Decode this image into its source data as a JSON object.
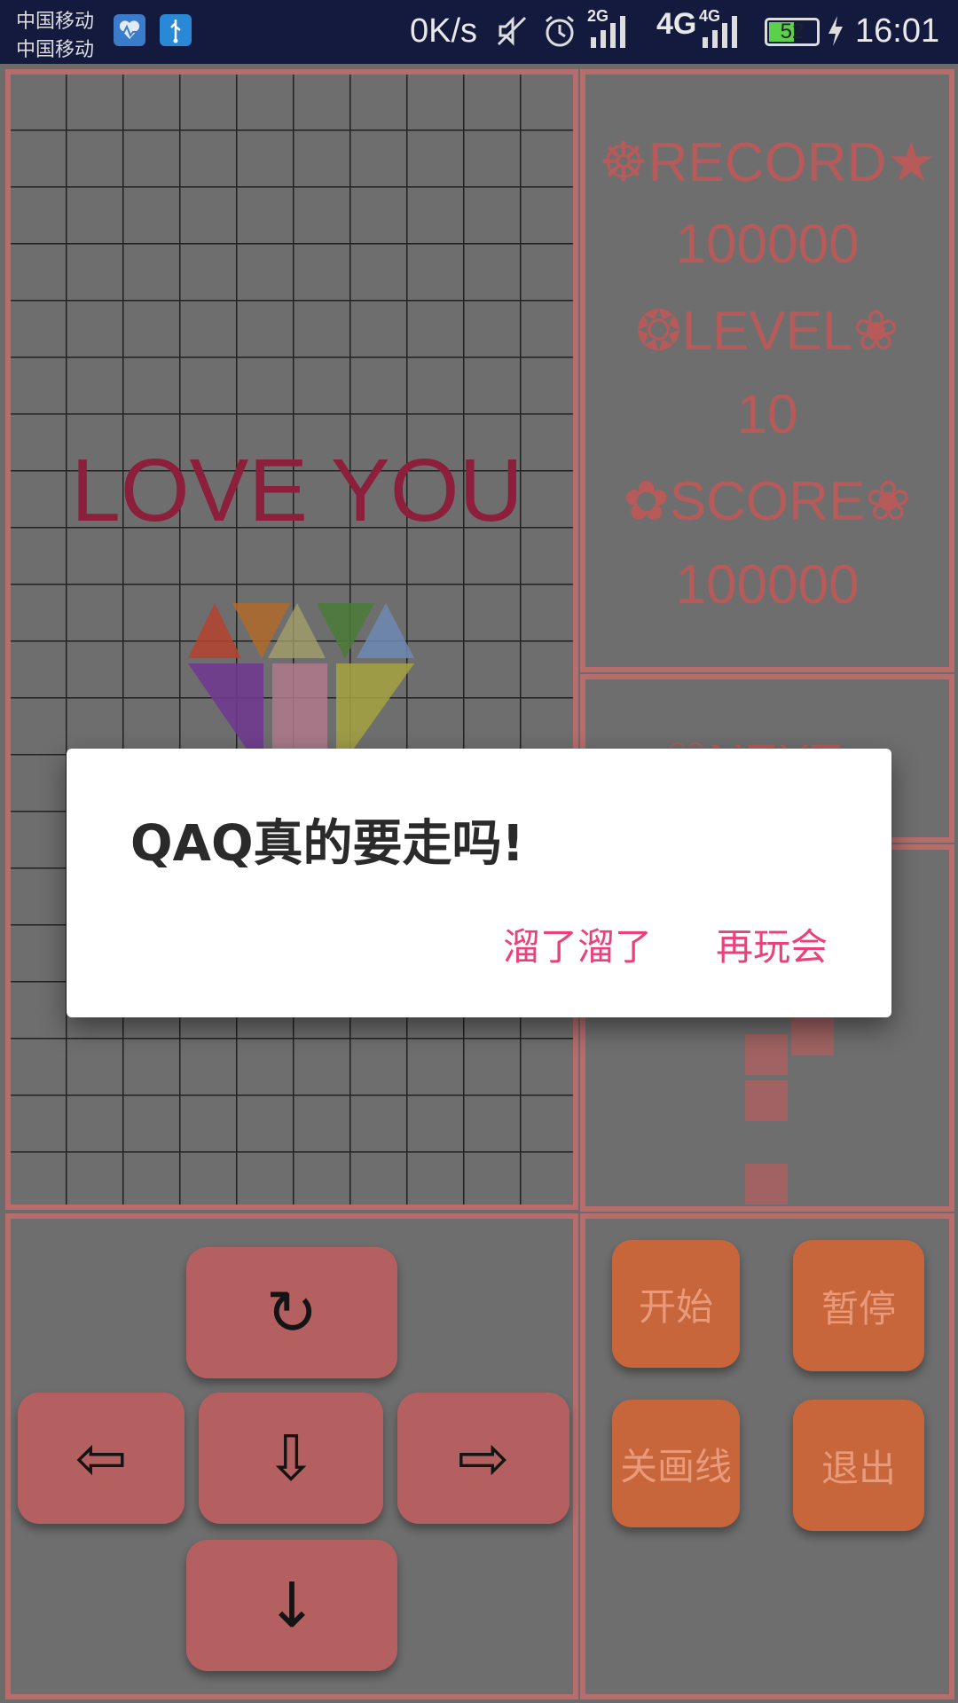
{
  "status_bar": {
    "carrier_1": "中国移动",
    "carrier_2": "中国移动",
    "net_speed": "0K/s",
    "network_2g": "2G",
    "network_4g_a": "4G",
    "network_4g_b": "4G",
    "battery_level": "52",
    "time": "16:01"
  },
  "game": {
    "love_text": "LOVE YOU",
    "record_label": "☸RECORD★",
    "record_value": "100000",
    "level_label": "❂LEVEL❀",
    "level_value": "10",
    "score_label": "✿SCORE❀",
    "score_value": "100000",
    "next_label": "♡NEXT♥"
  },
  "controls": {
    "rotate_label": "↻",
    "left_label": "⇦",
    "down_label": "⇩",
    "right_label": "⇨",
    "drop_label": "↓",
    "start_label": "开始",
    "pause_label": "暂停",
    "gridlines_label": "关画线",
    "exit_label": "退出"
  },
  "dialog": {
    "message": "QAQ真的要走吗!",
    "confirm_label": "溜了溜了",
    "cancel_label": "再玩会"
  },
  "colors": {
    "panel_border": "#b86c6c",
    "accent": "#e8417b",
    "side_button": "#c7653b",
    "love_text": "#8b1f3c"
  }
}
